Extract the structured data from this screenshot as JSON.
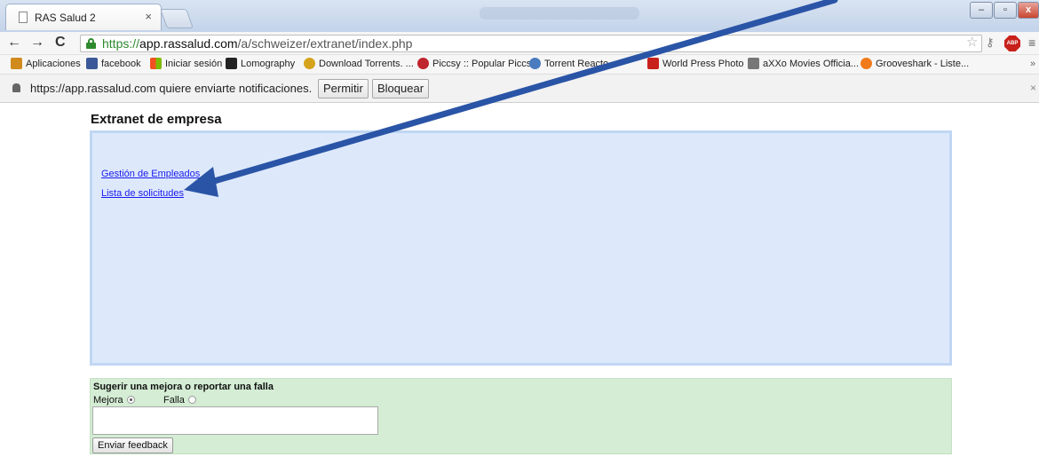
{
  "browser": {
    "tab_title": "RAS Salud 2",
    "tab_close": "×",
    "url_https": "https://",
    "url_host": "app.rassalud.com",
    "url_path": "/a/schweizer/extranet/index.php",
    "nav_back": "←",
    "nav_forward": "→",
    "nav_reload": "C",
    "window_min": "–",
    "window_max": "▫",
    "window_close": "x"
  },
  "bookmarks": [
    {
      "label": "Aplicaciones",
      "icon": "apps-grid-icon",
      "color": "#d08a1d"
    },
    {
      "label": "facebook",
      "icon": "facebook-icon",
      "color": "#3b5998"
    },
    {
      "label": "Iniciar sesión",
      "icon": "windows-icon",
      "color": "#f25022"
    },
    {
      "label": "Lomography",
      "icon": "camera-icon",
      "color": "#222222"
    },
    {
      "label": "Download Torrents. ...",
      "icon": "torrent-icon",
      "color": "#d6a31c"
    },
    {
      "label": "Piccsy :: Popular Piccs",
      "icon": "heart-icon",
      "color": "#c0262d"
    },
    {
      "label": "Torrent Reacto...",
      "icon": "torrent-reactor-icon",
      "color": "#4a7bbf"
    },
    {
      "label": "World Press Photo",
      "icon": "wpp-icon",
      "color": "#c8211b"
    },
    {
      "label": "aXXo Movies Officia...",
      "icon": "film-icon",
      "color": "#777777"
    },
    {
      "label": "Grooveshark - Liste...",
      "icon": "grooveshark-icon",
      "color": "#f07a1a"
    }
  ],
  "notification": {
    "text": "https://app.rassalud.com quiere enviarte notificaciones.",
    "allow": "Permitir",
    "block": "Bloquear"
  },
  "page": {
    "heading": "Extranet de empresa",
    "links": [
      "Gestión de Empleados",
      "Lista de solicitudes"
    ]
  },
  "feedback": {
    "title": "Sugerir una mejora o reportar una falla",
    "option_mejora": "Mejora",
    "option_falla": "Falla",
    "selected": "Mejora",
    "textarea_value": "",
    "submit": "Enviar feedback"
  },
  "colors": {
    "panel_bg": "#dde9fb",
    "feedback_bg": "#d4edd4",
    "link": "#1a1aee",
    "arrow": "#2a54a6"
  }
}
